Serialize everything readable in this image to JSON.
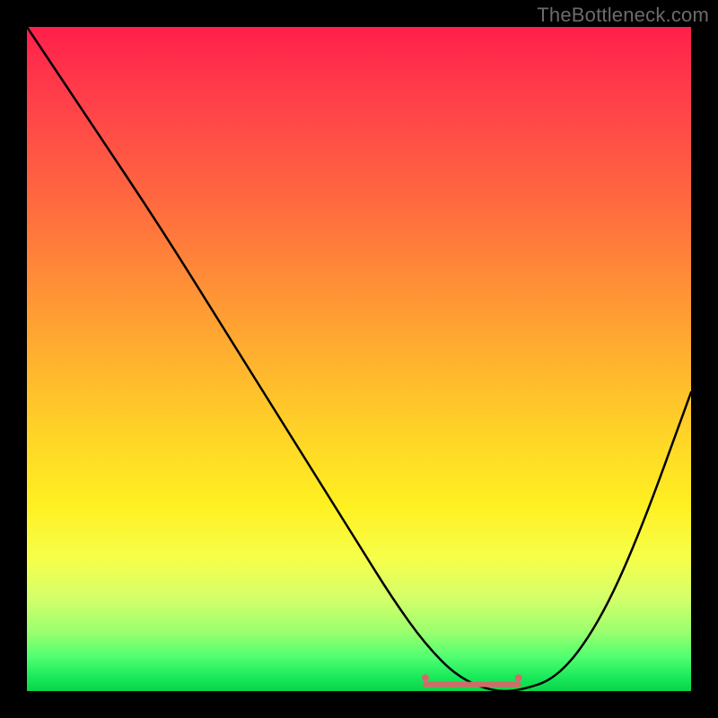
{
  "attribution": "TheBottleneck.com",
  "chart_data": {
    "type": "line",
    "title": "",
    "xlabel": "",
    "ylabel": "",
    "xlim": [
      0,
      100
    ],
    "ylim": [
      0,
      100
    ],
    "grid": false,
    "legend": false,
    "background_gradient_stops": [
      {
        "pct": 0,
        "color": "#ff1f4b"
      },
      {
        "pct": 10,
        "color": "#ff3d4a"
      },
      {
        "pct": 28,
        "color": "#ff6e3e"
      },
      {
        "pct": 45,
        "color": "#ffa232"
      },
      {
        "pct": 60,
        "color": "#ffd028"
      },
      {
        "pct": 72,
        "color": "#fff021"
      },
      {
        "pct": 80,
        "color": "#f6ff4a"
      },
      {
        "pct": 86,
        "color": "#d4ff6a"
      },
      {
        "pct": 91,
        "color": "#9cff6e"
      },
      {
        "pct": 95,
        "color": "#4dff70"
      },
      {
        "pct": 98,
        "color": "#18e85a"
      },
      {
        "pct": 100,
        "color": "#0bd447"
      }
    ],
    "series": [
      {
        "name": "bottleneck-curve",
        "color": "#000000",
        "x": [
          0,
          10,
          20,
          30,
          40,
          50,
          55,
          60,
          65,
          70,
          74,
          80,
          86,
          92,
          100
        ],
        "values": [
          100,
          85,
          70,
          54,
          38,
          22,
          14,
          7,
          2,
          0,
          0,
          2,
          10,
          23,
          45
        ]
      }
    ],
    "markers": [
      {
        "name": "flat-end-left",
        "x": 60,
        "y": 2,
        "color": "#d36a6a",
        "r": 4
      },
      {
        "name": "flat-end-right",
        "x": 74,
        "y": 2,
        "color": "#d36a6a",
        "r": 4
      }
    ],
    "highlight_segment": {
      "name": "optimal-range",
      "x_start": 60,
      "x_end": 74,
      "color": "#d36a6a",
      "thickness": 6
    }
  }
}
